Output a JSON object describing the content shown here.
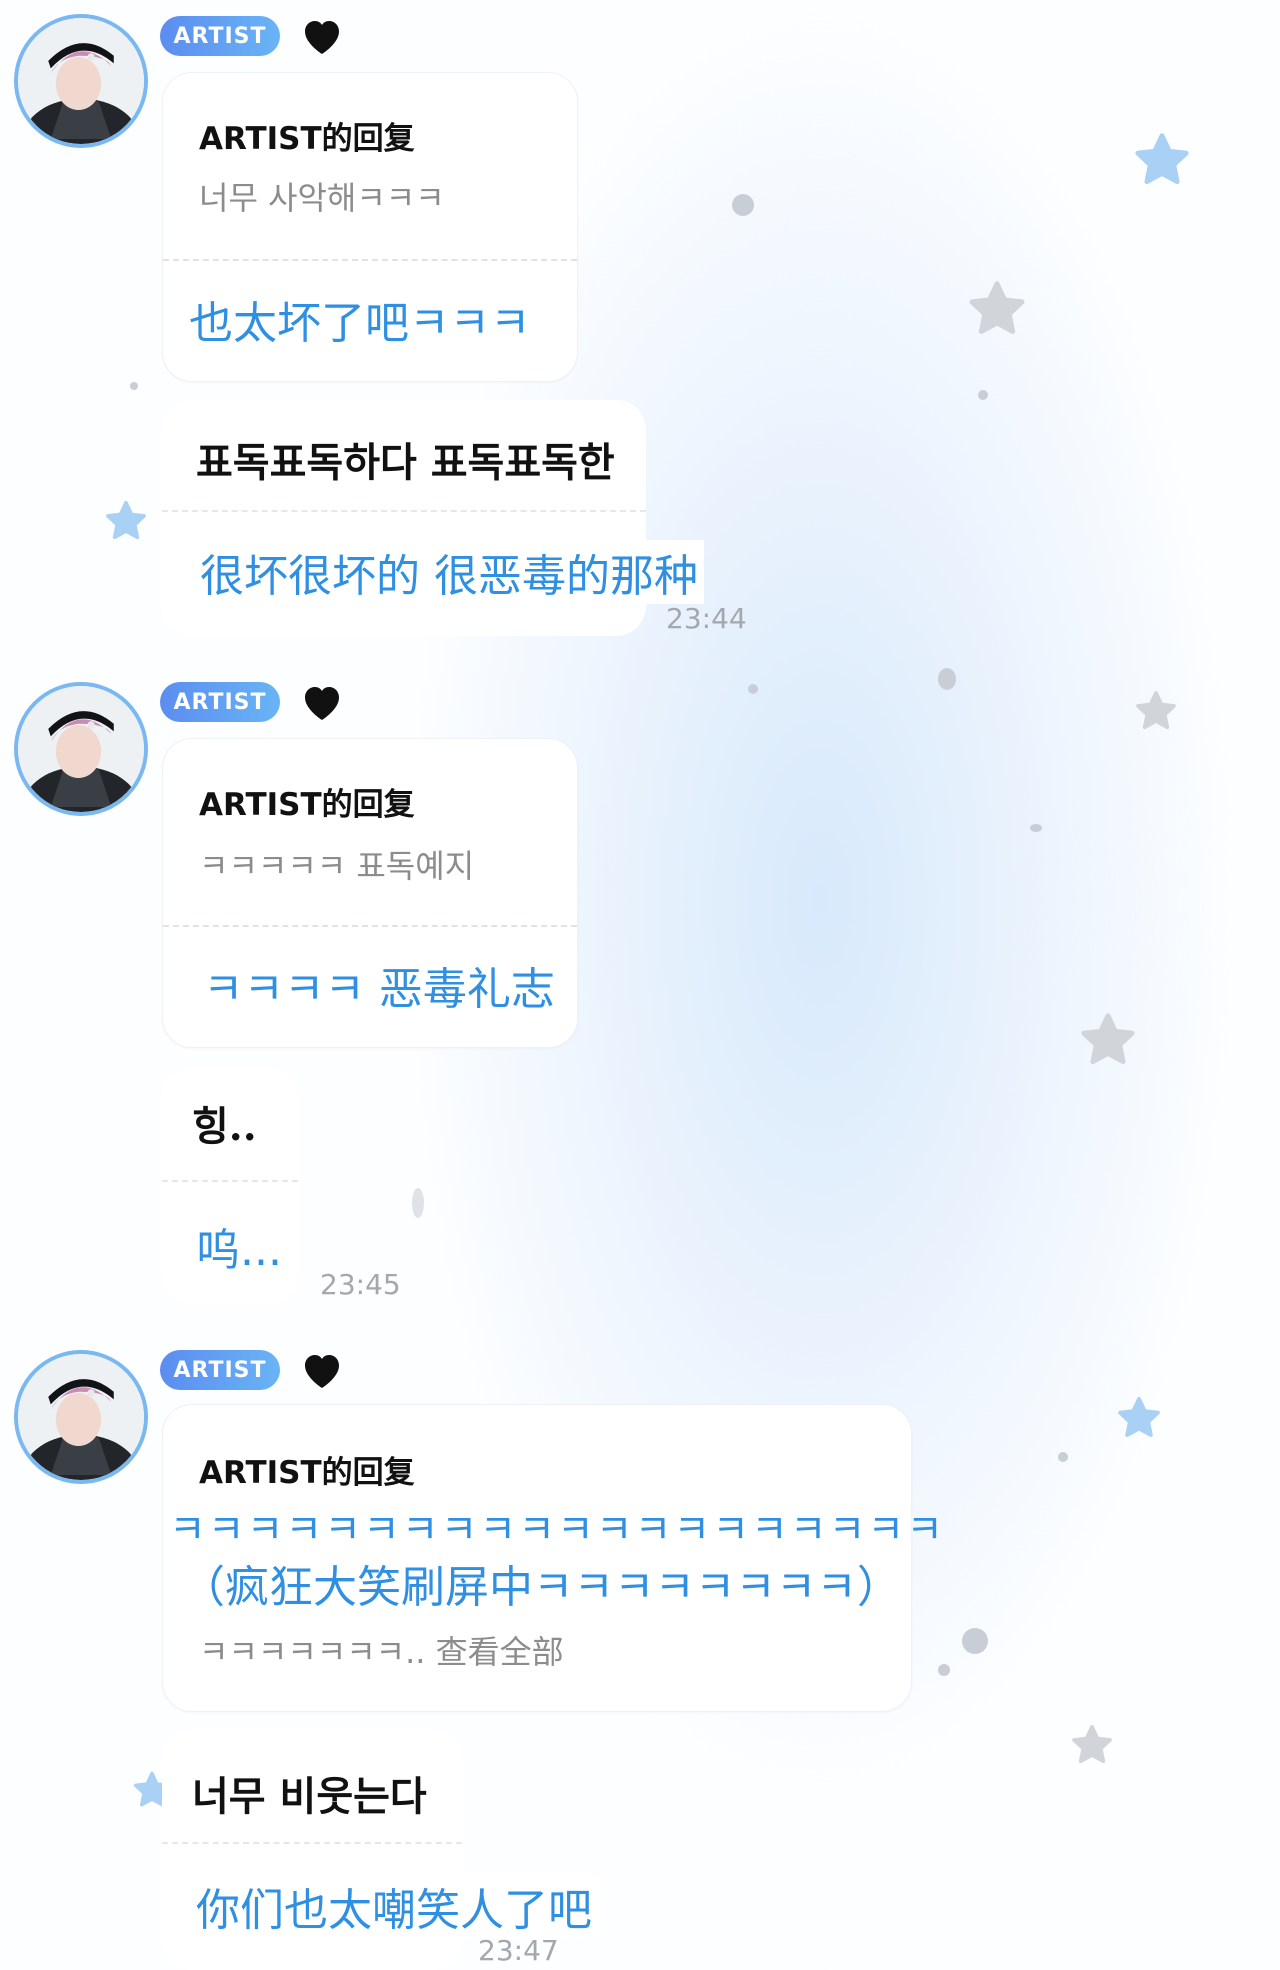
{
  "colors": {
    "accent": "#2f8fe3",
    "badge_start": "#5b8df0",
    "badge_end": "#69b4f5",
    "avatar_ring": "#79b8f0"
  },
  "icons": {
    "heart": "black-heart-icon",
    "star": "star-icon"
  },
  "messages": [
    {
      "badge": "ARTIST",
      "reply_header": "ARTIST的回复",
      "original": "너무 사악해ㅋㅋㅋ",
      "translation": "也太坏了吧ㅋㅋㅋ",
      "bubble_original": "표독표독하다 표독표독한",
      "bubble_translation": "很坏很坏的 很恶毒的那种",
      "time": "23:44"
    },
    {
      "badge": "ARTIST",
      "reply_header": "ARTIST的回复",
      "original": "ㅋㅋㅋㅋㅋ 표독예지",
      "translation": "ㅋㅋㅋㅋ 恶毒礼志",
      "bubble_original": "힝..",
      "bubble_translation": "呜...",
      "time": "23:45"
    },
    {
      "badge": "ARTIST",
      "reply_header": "ARTIST的回复",
      "translation_line1": "ㅋㅋㅋㅋㅋㅋㅋㅋㅋㅋㅋㅋㅋㅋㅋㅋㅋㅋㅋㅋ",
      "translation_line2": "（疯狂大笑刷屏中ㅋㅋㅋㅋㅋㅋㅋㅋ）",
      "original_preview": "ㅋㅋㅋㅋㅋㅋㅋ.. 查看全部",
      "bubble_original": "너무 비웃는다",
      "bubble_translation": "你们也太嘲笑人了吧",
      "time": "23:47"
    }
  ]
}
